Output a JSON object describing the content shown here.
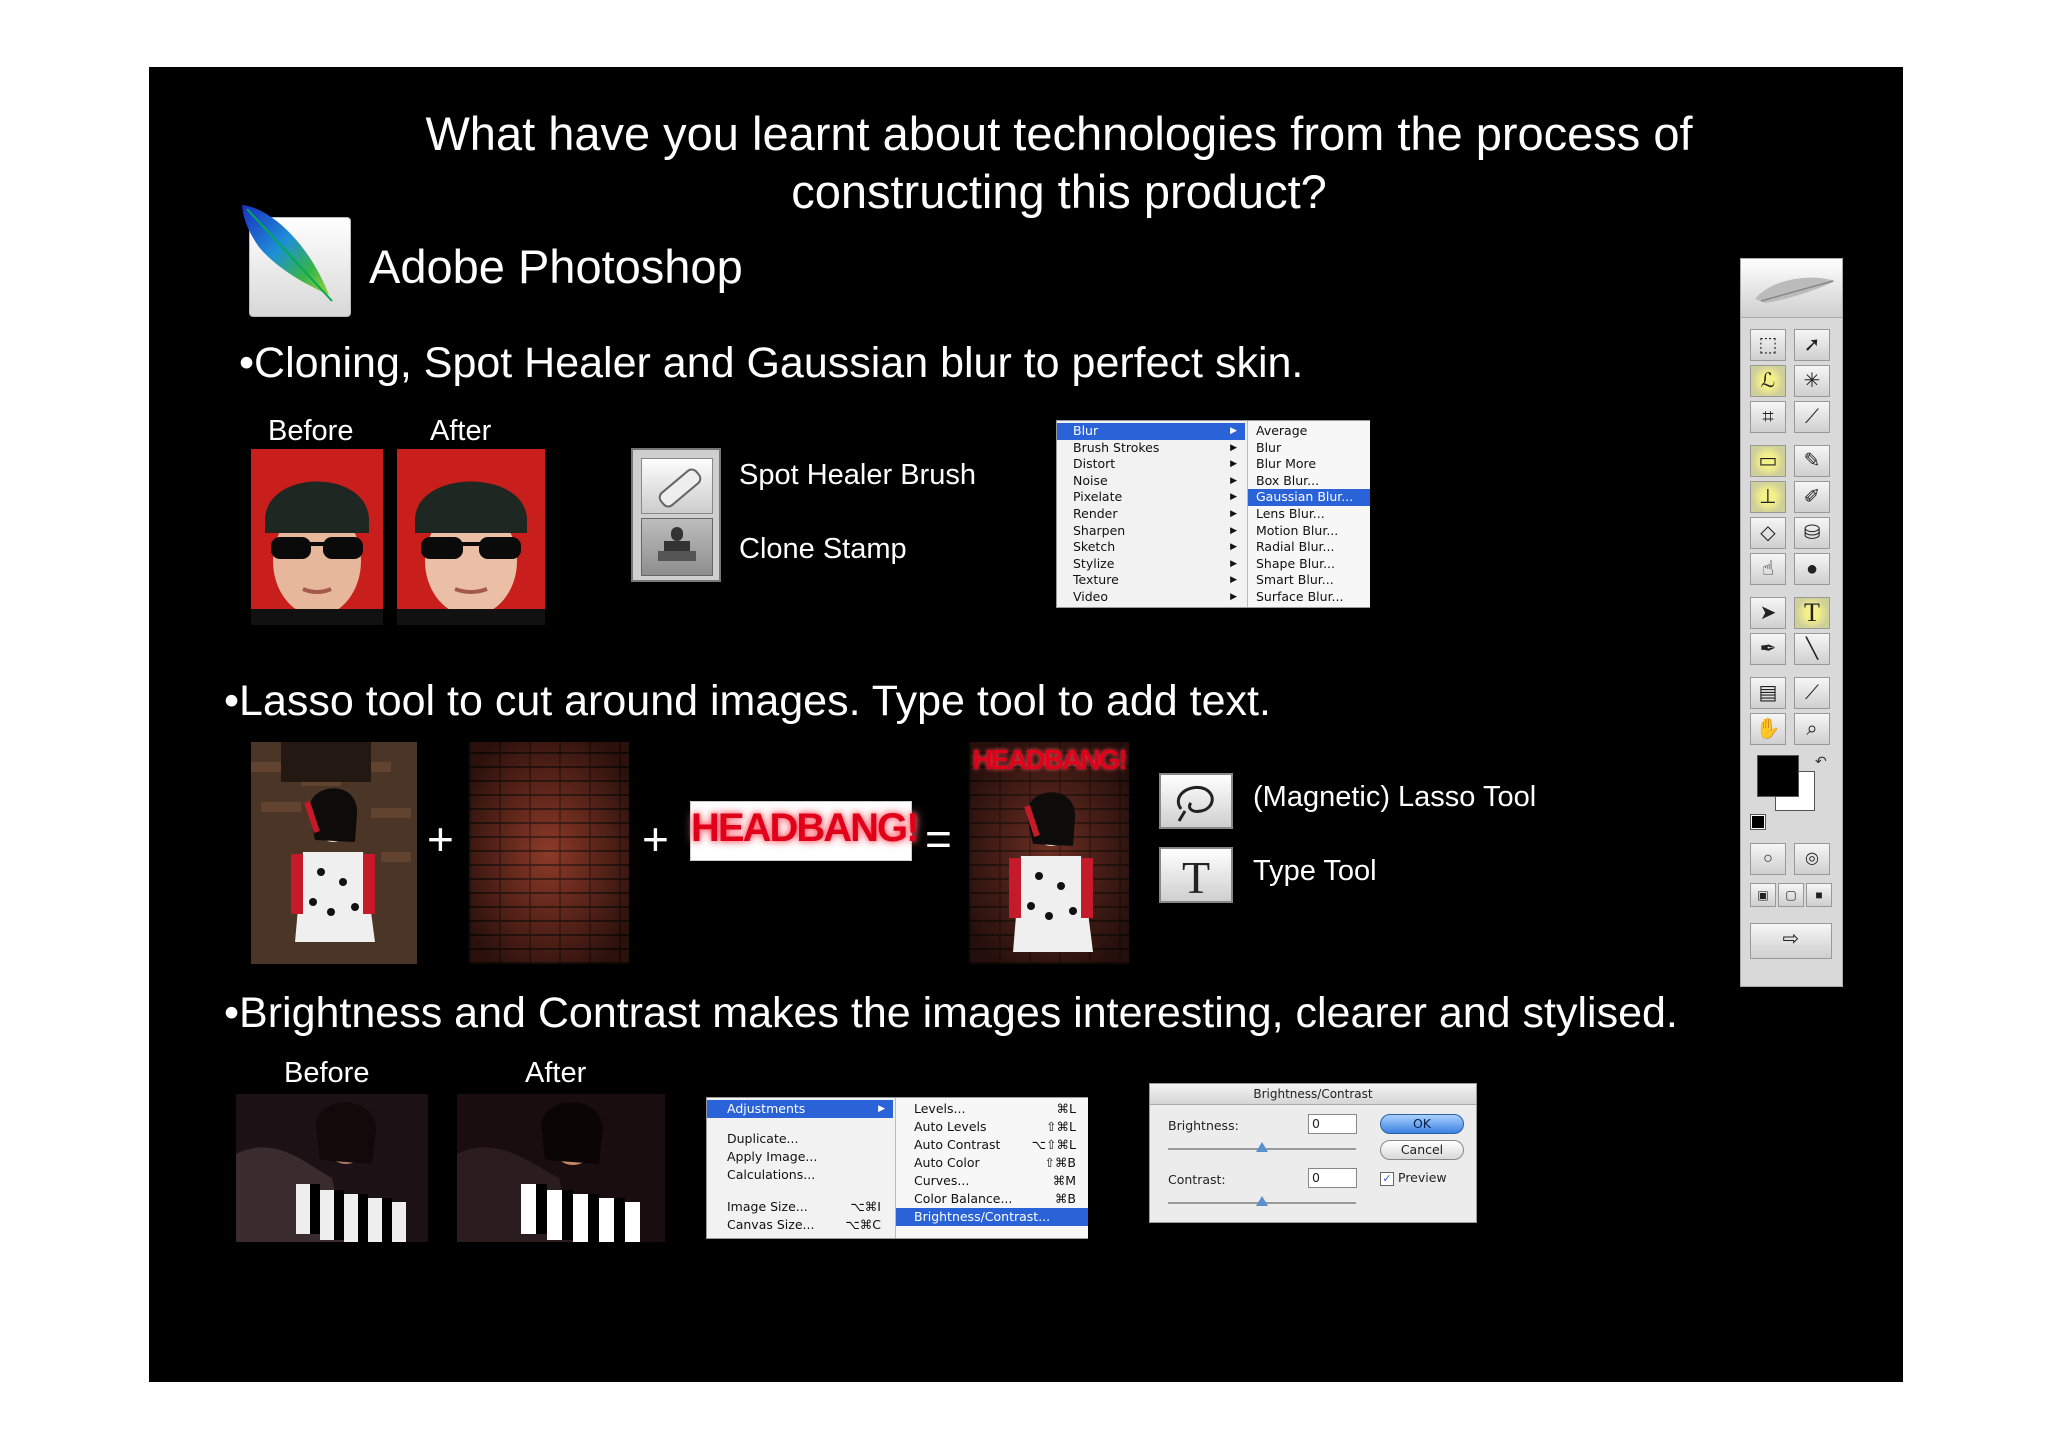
{
  "slide": {
    "title": "What have you learnt about technologies from the process of constructing this product?",
    "app_name": "Adobe Photoshop",
    "bullets": {
      "b1": "•Cloning, Spot Healer and Gaussian blur to perfect skin.",
      "b2": "•Lasso tool to cut around images. Type tool to add text.",
      "b3": "•Brightness and Contrast makes the images interesting, clearer and stylised."
    },
    "labels": {
      "before1": "Before",
      "after1": "After",
      "spot_healer": "Spot Healer Brush",
      "clone_stamp": "Clone Stamp",
      "lasso_tool": "(Magnetic) Lasso Tool",
      "type_tool": "Type Tool",
      "before2": "Before",
      "after2": "After"
    },
    "operators": {
      "plus1": "+",
      "plus2": "+",
      "equals": "="
    },
    "headbang": "HEADBANG!"
  },
  "filter_menu": {
    "left": [
      "Blur",
      "Brush Strokes",
      "Distort",
      "Noise",
      "Pixelate",
      "Render",
      "Sharpen",
      "Sketch",
      "Stylize",
      "Texture",
      "Video"
    ],
    "right": [
      "Average",
      "Blur",
      "Blur More",
      "Box Blur...",
      "Gaussian Blur...",
      "Lens Blur...",
      "Motion Blur...",
      "Radial Blur...",
      "Shape Blur...",
      "Smart Blur...",
      "Surface Blur..."
    ],
    "highlight_left": 0,
    "highlight_right": 4
  },
  "adjust_menu": {
    "left": [
      {
        "label": "Adjustments",
        "short": ""
      },
      {
        "label": "Duplicate...",
        "short": ""
      },
      {
        "label": "Apply Image...",
        "short": ""
      },
      {
        "label": "Calculations...",
        "short": ""
      },
      {
        "label": "Image Size...",
        "short": "⌥⌘I"
      },
      {
        "label": "Canvas Size...",
        "short": "⌥⌘C"
      }
    ],
    "right": [
      {
        "label": "Levels...",
        "short": "⌘L"
      },
      {
        "label": "Auto Levels",
        "short": "⇧⌘L"
      },
      {
        "label": "Auto Contrast",
        "short": "⌥⇧⌘L"
      },
      {
        "label": "Auto Color",
        "short": "⇧⌘B"
      },
      {
        "label": "Curves...",
        "short": "⌘M"
      },
      {
        "label": "Color Balance...",
        "short": "⌘B"
      },
      {
        "label": "Brightness/Contrast...",
        "short": ""
      }
    ]
  },
  "bc_dialog": {
    "title": "Brightness/Contrast",
    "brightness_label": "Brightness:",
    "brightness_value": "0",
    "contrast_label": "Contrast:",
    "contrast_value": "0",
    "ok": "OK",
    "cancel": "Cancel",
    "preview": "Preview"
  },
  "toolbox": {
    "type_glyph": "T"
  },
  "colors": {
    "slide_bg": "#000000",
    "menu_highlight": "#2a62d8",
    "headbang_red": "#e0001a"
  }
}
